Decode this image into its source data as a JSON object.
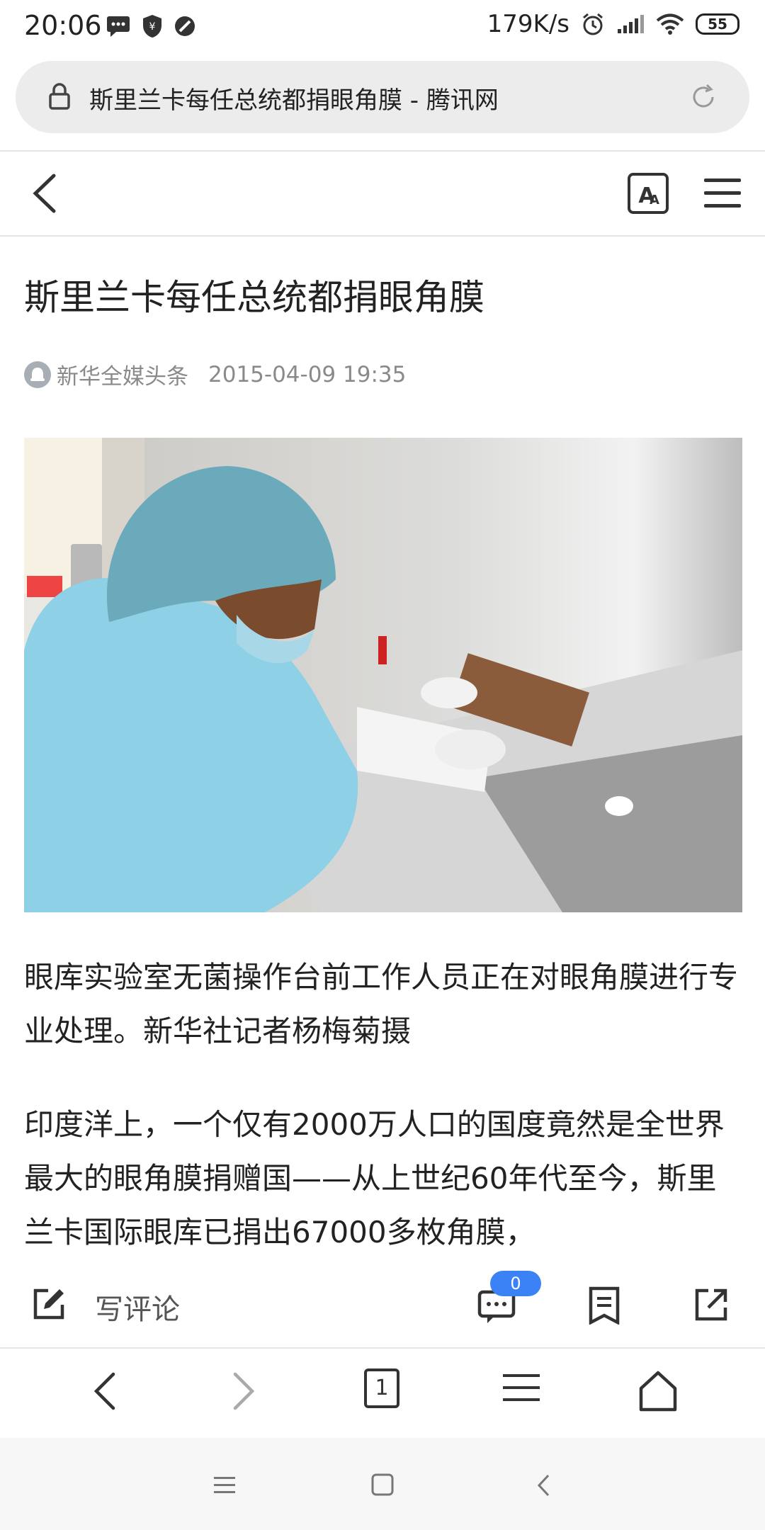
{
  "status_bar": {
    "time": "20:06",
    "network_speed": "179K/s",
    "battery_level": "55",
    "icons": [
      "message-icon",
      "shield-icon",
      "block-icon",
      "alarm-icon",
      "signal-icon",
      "wifi-icon",
      "battery-icon"
    ]
  },
  "url_bar": {
    "text": "斯里兰卡每任总统都捐眼角膜 - 腾讯网",
    "lock_icon": "lock-icon",
    "reload_icon": "reload-icon"
  },
  "article": {
    "title": "斯里兰卡每任总统都捐眼角膜",
    "source": "新华全媒头条",
    "date": "2015-04-09 19:35",
    "caption": "眼库实验室无菌操作台前工作人员正在对眼角膜进行专业处理。新华社记者杨梅菊摄",
    "paragraph": "印度洋上，一个仅有2000万人口的国度竟然是全世界最大的眼角膜捐赠国——从上世纪60年代至今，斯里兰卡国际眼库已捐出67000多枚角膜，"
  },
  "comment_bar": {
    "write_label": "写评论",
    "comment_count": "0"
  },
  "colors": {
    "accent": "#3b82f6",
    "url_bar_bg": "#ececec",
    "meta_text": "#8a8a8a"
  }
}
